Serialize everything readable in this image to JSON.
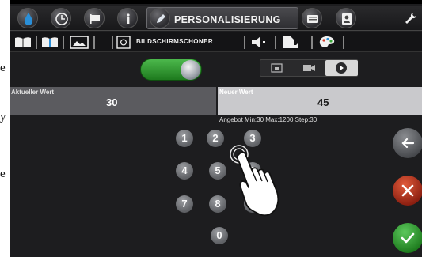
{
  "background_text": [
    "e",
    "y",
    "e"
  ],
  "tabs": {
    "active_label": "PERSONALISIERUNG",
    "items": [
      "water-drop-icon",
      "clock-icon",
      "flag-icon",
      "info-icon",
      "pencil-icon",
      "keyboard-icon",
      "user-card-icon",
      "wrench-icon"
    ]
  },
  "subtoolbar": {
    "label": "BILDSCHIRMSCHONER",
    "items": [
      "open-book-icon",
      "book-icon",
      "picture-icon",
      "screensaver-icon",
      "speaker-icon",
      "sound-file-icon",
      "palette-icon"
    ]
  },
  "toggle": {
    "state": "on"
  },
  "modes": [
    "monitor-icon",
    "video-camera-icon",
    "play-icon"
  ],
  "value_header": {
    "current_label": "Aktueller Wert",
    "current_value": "30",
    "new_label": "Neuer Wert",
    "new_value": "45"
  },
  "range_info": "Angebot Min:30 Max:1200 Step:30",
  "keypad": {
    "k1": "1",
    "k2": "2",
    "k3": "3",
    "k4": "4",
    "k5": "5",
    "k6": "6",
    "k7": "7",
    "k8": "8",
    "k9": "9",
    "k0": "0"
  },
  "colors": {
    "accent_green": "#2e9a2e",
    "cancel_red": "#b3301c",
    "panel_dark": "#1d1d1f"
  }
}
